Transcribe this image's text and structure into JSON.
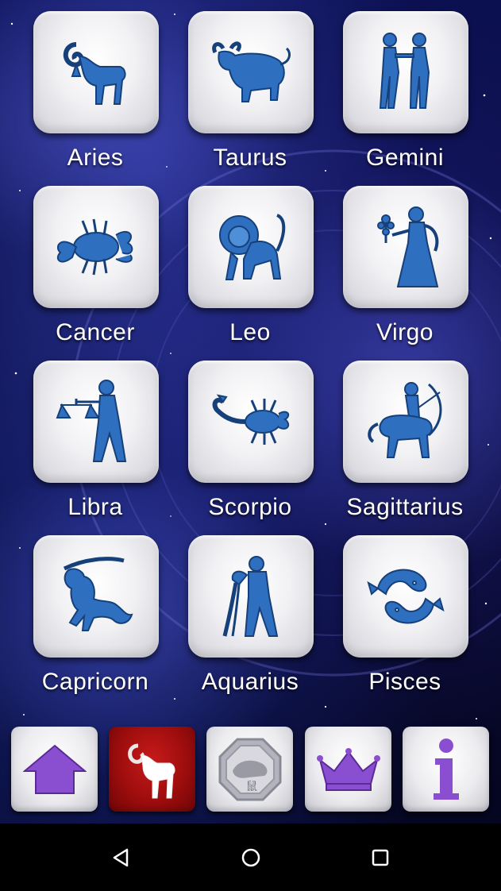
{
  "signs": [
    {
      "name": "Aries",
      "icon": "aries-ram-icon"
    },
    {
      "name": "Taurus",
      "icon": "taurus-bull-icon"
    },
    {
      "name": "Gemini",
      "icon": "gemini-twins-icon"
    },
    {
      "name": "Cancer",
      "icon": "cancer-crab-icon"
    },
    {
      "name": "Leo",
      "icon": "leo-lion-icon"
    },
    {
      "name": "Virgo",
      "icon": "virgo-maiden-icon"
    },
    {
      "name": "Libra",
      "icon": "libra-scales-icon"
    },
    {
      "name": "Scorpio",
      "icon": "scorpio-scorpion-icon"
    },
    {
      "name": "Sagittarius",
      "icon": "sagittarius-archer-icon"
    },
    {
      "name": "Capricorn",
      "icon": "capricorn-goat-icon"
    },
    {
      "name": "Aquarius",
      "icon": "aquarius-water-bearer-icon"
    },
    {
      "name": "Pisces",
      "icon": "pisces-fish-icon"
    }
  ],
  "toolbar": {
    "buttons": [
      {
        "icon": "home-icon",
        "active": false
      },
      {
        "icon": "aries-ram-icon",
        "active": true
      },
      {
        "icon": "chinese-rat-icon",
        "active": false
      },
      {
        "icon": "crown-icon",
        "active": false
      },
      {
        "icon": "info-icon",
        "active": false
      }
    ],
    "rat_glyph": "鼠"
  },
  "colors": {
    "symbol_blue": "#2f6fc0",
    "toolbar_purple": "#8a4fd0",
    "active_red": "#a80f0f"
  },
  "nav": {
    "back": "back-icon",
    "home": "home-circle-icon",
    "recents": "recents-icon"
  }
}
